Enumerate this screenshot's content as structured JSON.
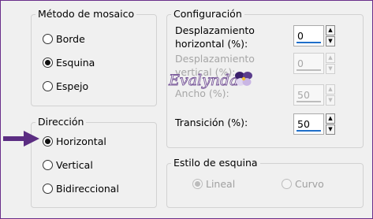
{
  "tile_method": {
    "title": "Método de mosaico",
    "options": [
      {
        "label": "Borde",
        "checked": false
      },
      {
        "label": "Esquina",
        "checked": true
      },
      {
        "label": "Espejo",
        "checked": false
      }
    ]
  },
  "direction": {
    "title": "Dirección",
    "options": [
      {
        "label": "Horizontal",
        "checked": true
      },
      {
        "label": "Vertical",
        "checked": false
      },
      {
        "label": "Bidireccional",
        "checked": false
      }
    ]
  },
  "config": {
    "title": "Configuración",
    "h_offset": {
      "label_line1": "Desplazamiento",
      "label_line2": "horizontal (%):",
      "value": "0",
      "enabled": true
    },
    "v_offset": {
      "label_line1": "Desplazamiento",
      "label_line2": "vertical (%):",
      "value": "0",
      "enabled": false
    },
    "width": {
      "label": "Ancho (%):",
      "value": "50",
      "enabled": false
    },
    "transition": {
      "label": "Transición (%):",
      "value": "50",
      "enabled": true
    }
  },
  "corner_style": {
    "title": "Estilo de esquina",
    "options": [
      {
        "label": "Lineal",
        "checked": true,
        "enabled": false
      },
      {
        "label": "Curvo",
        "checked": false,
        "enabled": false
      }
    ]
  },
  "watermark": {
    "text": "Evalynda"
  },
  "colors": {
    "pointer_arrow": "#5b2d82",
    "accent_underline": "#1f6fc9",
    "frame_border": "#6a2f8a"
  }
}
